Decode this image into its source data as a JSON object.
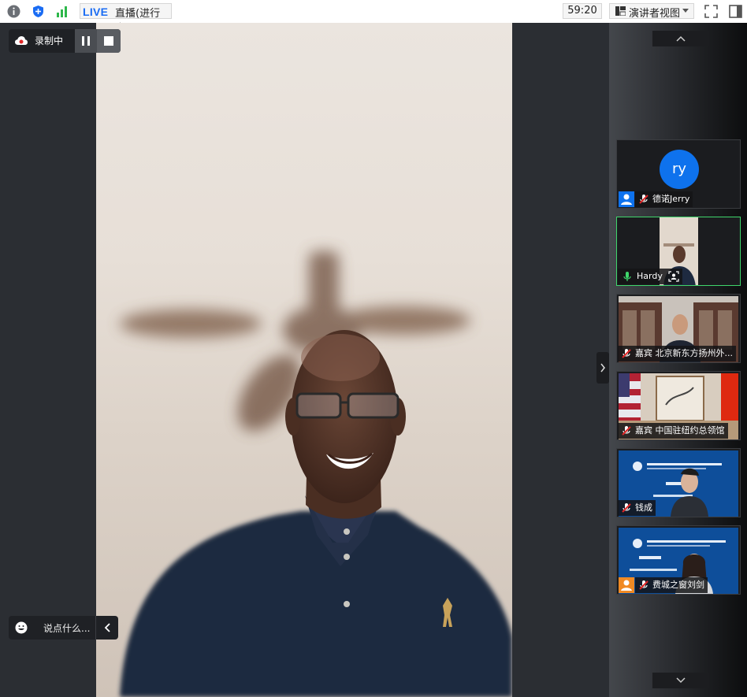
{
  "topbar": {
    "live_label": "LIVE",
    "live_status": "直播(进行中)",
    "timer": "59:20",
    "view_label": "演讲者视图",
    "icons": [
      "info-icon",
      "shield-icon",
      "signal-icon",
      "fullscreen-icon",
      "sidebar-toggle-icon"
    ]
  },
  "recording": {
    "label": "录制中"
  },
  "chat": {
    "placeholder": "说点什么..."
  },
  "gallery": {
    "participants": [
      {
        "avatar": "ry",
        "name": "德诺Jerry"
      },
      {
        "name": "Hardy"
      },
      {
        "name": "嘉宾 北京新东方扬州外..."
      },
      {
        "name": "嘉宾 中国驻纽约总领馆"
      },
      {
        "name": "钱成"
      },
      {
        "name": "费城之窗刘剑"
      }
    ]
  },
  "colors": {
    "accent": "#0e72ed",
    "live_blue": "#1a6cf3",
    "active_border": "#3fd66b",
    "mic_muted": "#e02828",
    "mic_on": "#3fd66b"
  }
}
